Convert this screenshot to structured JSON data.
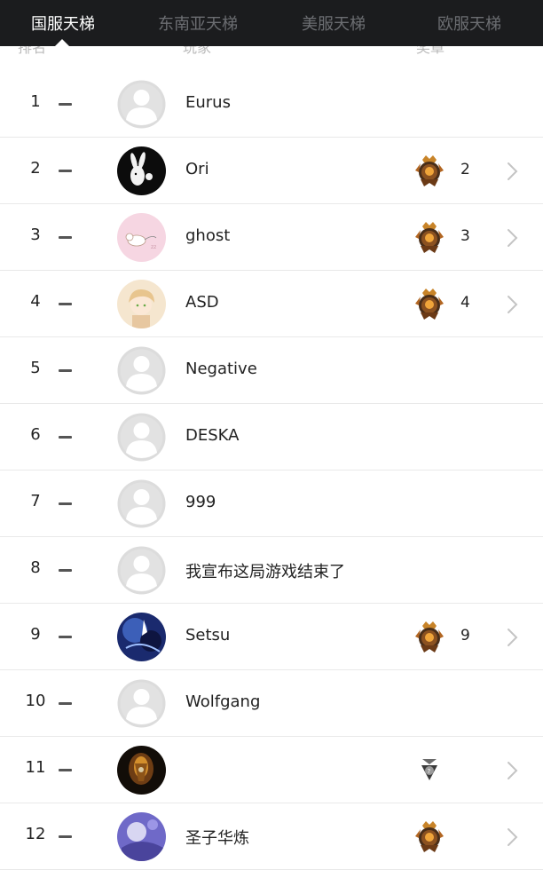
{
  "tabs": [
    {
      "label": "国服天梯",
      "active": true
    },
    {
      "label": "东南亚天梯",
      "active": false
    },
    {
      "label": "美服天梯",
      "active": false
    },
    {
      "label": "欧服天梯",
      "active": false
    }
  ],
  "columns": {
    "rank": "排名",
    "player": "玩家",
    "medal": "奖章"
  },
  "rows": [
    {
      "rank": "1",
      "name": "Eurus",
      "avatar": "default-avatar-icon",
      "medal": null,
      "count": ""
    },
    {
      "rank": "2",
      "name": "Ori",
      "avatar": "rabbit-avatar",
      "medal": "immortal-medal-icon",
      "count": "2"
    },
    {
      "rank": "3",
      "name": "ghost",
      "avatar": "pink-cat-avatar",
      "medal": "immortal-medal-icon",
      "count": "3"
    },
    {
      "rank": "4",
      "name": "ASD",
      "avatar": "anime-avatar",
      "medal": "immortal-medal-icon",
      "count": "4"
    },
    {
      "rank": "5",
      "name": "Negative",
      "avatar": "default-avatar-icon",
      "medal": null,
      "count": ""
    },
    {
      "rank": "6",
      "name": "DESKA",
      "avatar": "default-avatar-icon",
      "medal": null,
      "count": ""
    },
    {
      "rank": "7",
      "name": "999",
      "avatar": "default-avatar-icon",
      "medal": null,
      "count": ""
    },
    {
      "rank": "8",
      "name": "我宣布这局游戏结束了",
      "avatar": "default-avatar-icon",
      "medal": null,
      "count": ""
    },
    {
      "rank": "9",
      "name": "Setsu",
      "avatar": "blue-art-avatar",
      "medal": "immortal-medal-icon",
      "count": "9"
    },
    {
      "rank": "10",
      "name": "Wolfgang",
      "avatar": "default-avatar-icon",
      "medal": null,
      "count": ""
    },
    {
      "rank": "11",
      "name": "",
      "avatar": "dark-portrait-avatar",
      "medal": "small-silver-medal-icon",
      "count": ""
    },
    {
      "rank": "12",
      "name": "圣子华炼",
      "avatar": "purple-avatar",
      "medal": "immortal-medal-icon",
      "count": ""
    }
  ],
  "colors": {
    "tabbar": "#1b1c1e",
    "tab_inactive": "#6c6e72",
    "tab_active": "#ffffff"
  }
}
